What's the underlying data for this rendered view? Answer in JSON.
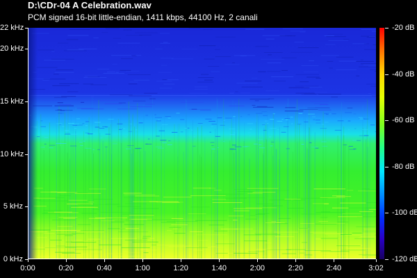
{
  "header": {
    "file_title": "D:\\CDr-04 A Celebration.wav",
    "format_info": "PCM signed 16-bit little-endian, 1411 kbps, 44100 Hz, 2 canali"
  },
  "frequency_axis": {
    "ticks": [
      {
        "value_khz": 22,
        "label": "22 kHz"
      },
      {
        "value_khz": 20,
        "label": "20 kHz"
      },
      {
        "value_khz": 15,
        "label": "15 kHz"
      },
      {
        "value_khz": 10,
        "label": "10 kHz"
      },
      {
        "value_khz": 5,
        "label": "5 kHz"
      },
      {
        "value_khz": 0,
        "label": "0 kHz"
      }
    ],
    "range_khz": [
      0,
      22
    ]
  },
  "time_axis": {
    "ticks": [
      {
        "seconds": 0,
        "label": "0:00"
      },
      {
        "seconds": 20,
        "label": "0:20"
      },
      {
        "seconds": 40,
        "label": "0:40"
      },
      {
        "seconds": 60,
        "label": "1:00"
      },
      {
        "seconds": 80,
        "label": "1:20"
      },
      {
        "seconds": 100,
        "label": "1:40"
      },
      {
        "seconds": 120,
        "label": "2:00"
      },
      {
        "seconds": 140,
        "label": "2:20"
      },
      {
        "seconds": 160,
        "label": "2:40"
      },
      {
        "seconds": 182,
        "label": "3:02"
      }
    ],
    "range_seconds": [
      0,
      182
    ]
  },
  "colorbar": {
    "ticks": [
      {
        "db": -20,
        "label": "-20 dB"
      },
      {
        "db": -40,
        "label": "-40 dB"
      },
      {
        "db": -60,
        "label": "-60 dB"
      },
      {
        "db": -80,
        "label": "-80 dB"
      },
      {
        "db": -100,
        "label": "-100 dB"
      },
      {
        "db": -120,
        "label": "-120 dB"
      }
    ],
    "range_db": [
      -120,
      -20
    ]
  },
  "colors": {
    "background": "#000000",
    "text": "#ffffff",
    "high_band": "#1430e6",
    "mid_band": "#20c8ff",
    "low_band": "#3cf03c",
    "bass_band": "#d8ff28"
  }
}
